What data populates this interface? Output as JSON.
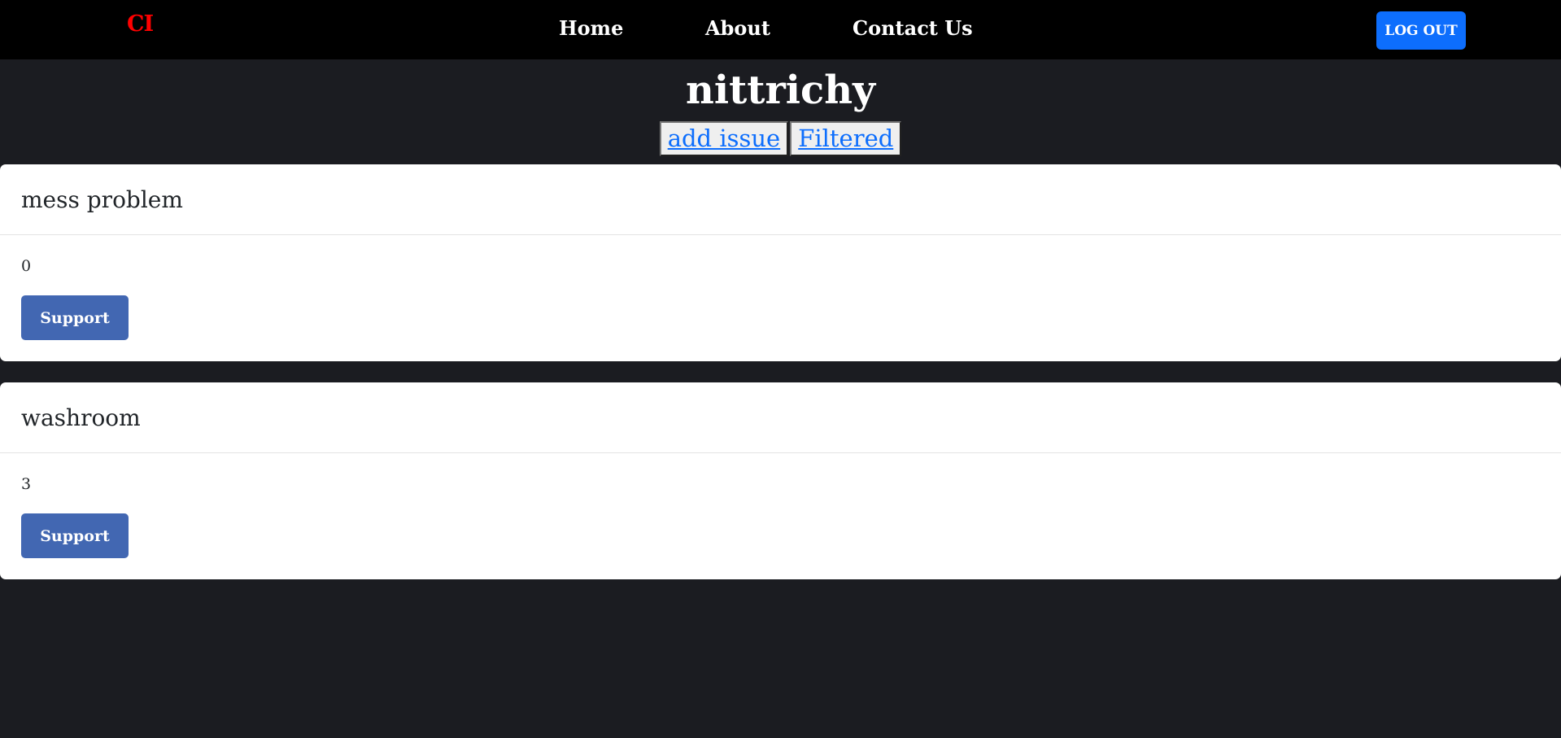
{
  "navbar": {
    "brand": "CI",
    "links": [
      "Home",
      "About",
      "Contact Us"
    ],
    "logout_label": "LOG OUT"
  },
  "page": {
    "title": "nittrichy",
    "actions": [
      "add issue",
      "Filtered"
    ]
  },
  "issues": [
    {
      "title": "mess problem",
      "count": "0",
      "support_label": "Support"
    },
    {
      "title": "washroom",
      "count": "3",
      "support_label": "Support"
    }
  ],
  "colors": {
    "background": "#1b1c21",
    "navbar": "#000000",
    "brand": "#ff0000",
    "logout": "#0d6efd",
    "support": "#4267b2",
    "link": "#0d6efd"
  }
}
